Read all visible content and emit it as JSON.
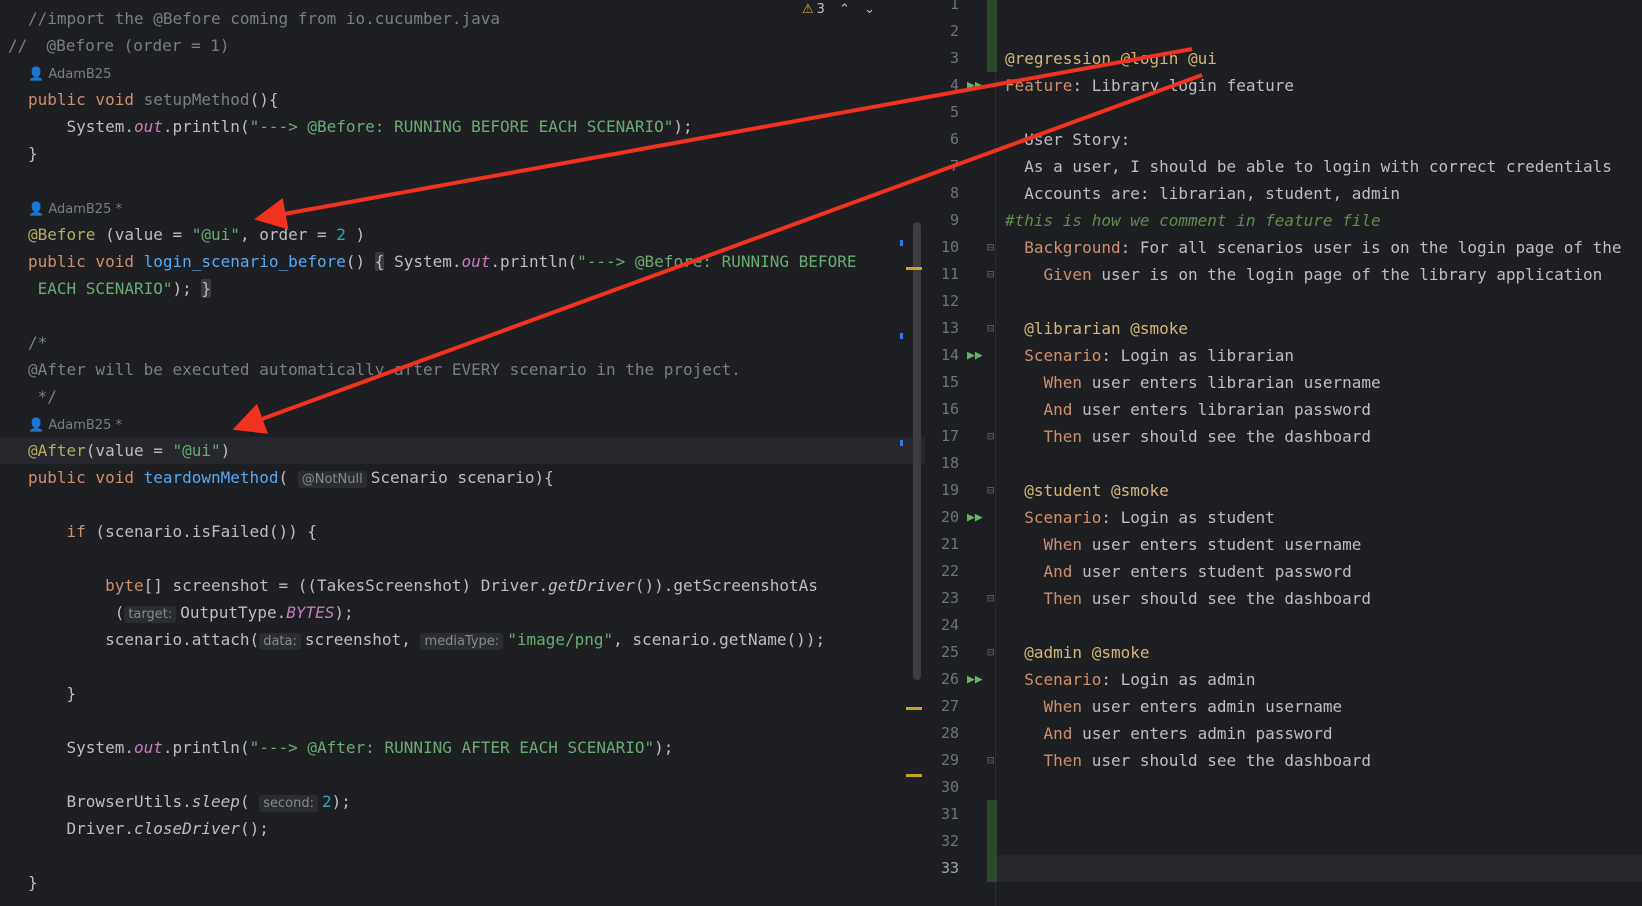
{
  "java": {
    "toolbar": {
      "warning_count": "3",
      "prev": "⌃",
      "next": "⌄"
    },
    "l1": "//import the @Before coming from io.cucumber.java",
    "l2": "//  @Before (order = 1)",
    "author1": "AdamB25",
    "l4a": "public void ",
    "l4b": "setupMethod",
    "l4c": "(){",
    "l5a": "    System.",
    "l5b": "out",
    "l5c": ".println(",
    "l5d": "\"---> @Before: RUNNING BEFORE EACH SCENARIO\"",
    "l5e": ");",
    "l6": "}",
    "author2": "AdamB25 *",
    "l9a": "@Before",
    "l9b": " (value = ",
    "l9c": "\"@ui\"",
    "l9d": ", order = ",
    "l9e": "2",
    "l9f": " )",
    "l10a": "public void ",
    "l10b": "login_scenario_before",
    "l10c": "() ",
    "l10d": "{",
    "l10e": " System.",
    "l10f": "out",
    "l10g": ".println(",
    "l10h": "\"---> @Before: RUNNING BEFORE",
    "l11a": " EACH SCENARIO\"",
    "l11b": "); ",
    "l11c": "}",
    "l13": "/*",
    "l14": "@After will be executed automatically after EVERY scenario in the project.",
    "l15": " */",
    "author3": "AdamB25 *",
    "l17a": "@After",
    "l17b": "(value = ",
    "l17c": "\"@ui\"",
    "l17d": ")",
    "l18a": "public void ",
    "l18b": "teardownMethod",
    "l18c": "( ",
    "l18hint": "@NotNull",
    "l18d": "Scenario scenario){",
    "l20a": "    ",
    "l20b": "if",
    "l20c": " (scenario.isFailed()) {",
    "l22a": "        ",
    "l22b": "byte",
    "l22c": "[] screenshot = ((TakesScreenshot) Driver.",
    "l22d": "getDriver",
    "l22e": "()).getScreenshotAs",
    "l23a": "         (",
    "l23hint": "target:",
    "l23b": "OutputType.",
    "l23c": "BYTES",
    "l23d": ");",
    "l24a": "        scenario.attach(",
    "l24hint1": "data:",
    "l24b": "screenshot, ",
    "l24hint2": "mediaType:",
    "l24c": "\"image/png\"",
    "l24d": ", scenario.getName());",
    "l26": "    }",
    "l28a": "    System.",
    "l28b": "out",
    "l28c": ".println(",
    "l28d": "\"---> @After: RUNNING AFTER EACH SCENARIO\"",
    "l28e": ");",
    "l30a": "    BrowserUtils.",
    "l30b": "sleep",
    "l30c": "( ",
    "l30hint": "second:",
    "l30d": "2",
    "l30e": ");",
    "l31a": "    Driver.",
    "l31b": "closeDriver",
    "l31c": "();",
    "l33": "}"
  },
  "feature": {
    "line_numbers": [
      "1",
      "2",
      "3",
      "4",
      "5",
      "6",
      "7",
      "8",
      "9",
      "10",
      "11",
      "12",
      "13",
      "14",
      "15",
      "16",
      "17",
      "18",
      "19",
      "20",
      "21",
      "22",
      "23",
      "24",
      "25",
      "26",
      "27",
      "28",
      "29",
      "30",
      "31",
      "32",
      "33"
    ],
    "f3": "@regression @login @ui",
    "f4a": "Feature",
    "f4b": ": Library login feature",
    "f6": "  User Story:",
    "f7": "  As a user, I should be able to login with correct credentials",
    "f8": "  Accounts are: librarian, student, admin",
    "f9": "#this is how we comment in feature file",
    "f10a": "  Background",
    "f10b": ": For all scenarios user is on the login page of the",
    "f11a": "    Given",
    "f11b": " user is on the login page of the library application",
    "f13": "  @librarian @smoke",
    "f14a": "  Scenario",
    "f14b": ": Login as librarian",
    "f15a": "    When",
    "f15b": " user enters librarian username",
    "f16a": "    And",
    "f16b": " user enters librarian password",
    "f17a": "    Then",
    "f17b": " user should see the dashboard",
    "f19": "  @student @smoke",
    "f20a": "  Scenario",
    "f20b": ": Login as student",
    "f21a": "    When",
    "f21b": " user enters student username",
    "f22a": "    And",
    "f22b": " user enters student password",
    "f23a": "    Then",
    "f23b": " user should see the dashboard",
    "f25": "  @admin @smoke",
    "f26a": "  Scenario",
    "f26b": ": Login as admin",
    "f27a": "    When",
    "f27b": " user enters admin username",
    "f28a": "    And",
    "f28b": " user enters admin password",
    "f29a": "    Then",
    "f29b": " user should see the dashboard"
  },
  "colors": {
    "arrow": "#f0321e",
    "background": "#1e1f22",
    "run_icon": "#5fb865"
  }
}
